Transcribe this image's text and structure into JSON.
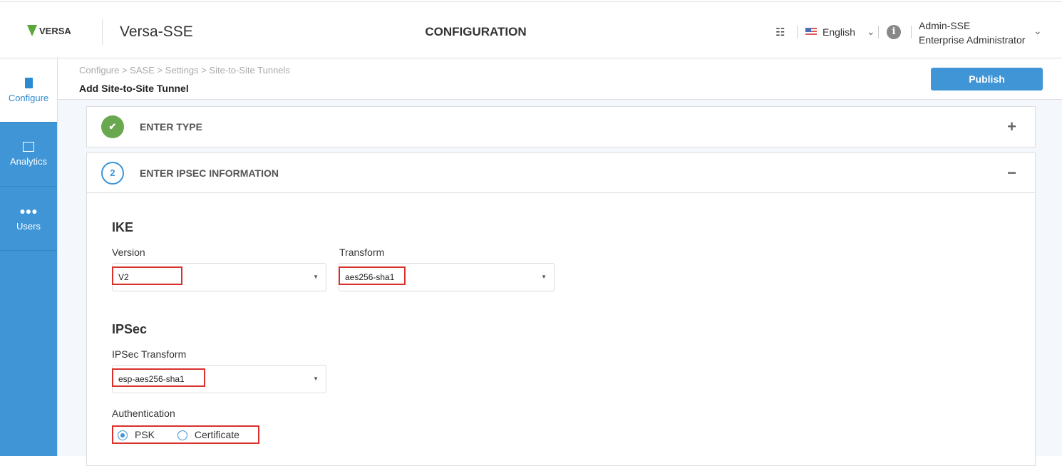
{
  "header": {
    "logo_text": "VERSA",
    "app_name": "Versa-SSE",
    "title": "CONFIGURATION",
    "language": "English",
    "user_name": "Admin-SSE",
    "user_role": "Enterprise Administrator"
  },
  "sidebar": {
    "items": [
      {
        "label": "Configure",
        "active": true
      },
      {
        "label": "Analytics"
      },
      {
        "label": "Users"
      }
    ]
  },
  "page": {
    "breadcrumb": "Configure > SASE > Settings > Site-to-Site Tunnels",
    "title": "Add Site-to-Site Tunnel",
    "publish_label": "Publish"
  },
  "steps": [
    {
      "number": "",
      "label": "ENTER TYPE",
      "status": "complete",
      "toggle": "+"
    },
    {
      "number": "2",
      "label": "ENTER IPSEC INFORMATION",
      "status": "active",
      "toggle": "−"
    }
  ],
  "form": {
    "ike_heading": "IKE",
    "version_label": "Version",
    "version_value": "V2",
    "transform_label": "Transform",
    "transform_value": "aes256-sha1",
    "ipsec_heading": "IPSec",
    "ipsec_transform_label": "IPSec Transform",
    "ipsec_transform_value": "esp-aes256-sha1",
    "auth_label": "Authentication",
    "auth_options": [
      "PSK",
      "Certificate"
    ],
    "auth_selected": "PSK"
  },
  "colors": {
    "accent": "#3f95d6",
    "success": "#6aa84f",
    "highlight": "#d9302c"
  }
}
